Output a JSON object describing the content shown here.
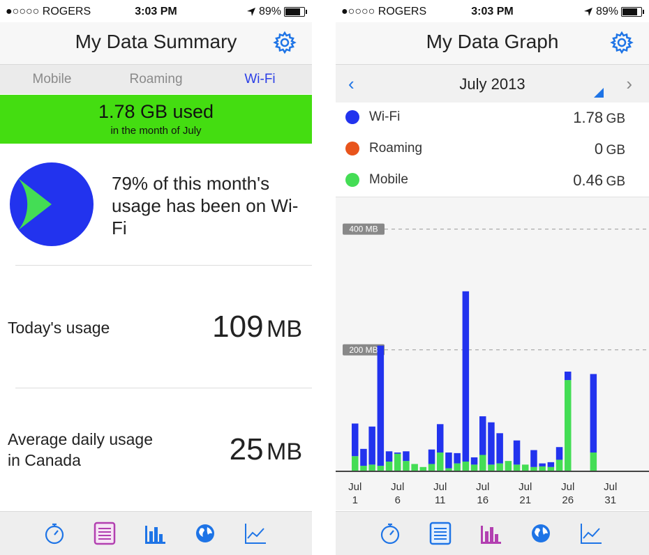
{
  "status": {
    "carrier": "●○○○○ ROGERS",
    "time": "3:03 PM",
    "battery": "89%",
    "battery_level": 0.89
  },
  "summary": {
    "title": "My Data Summary",
    "tabs": [
      "Mobile",
      "Roaming",
      "Wi-Fi"
    ],
    "active_tab": "Wi-Fi",
    "used_value": "1.78 GB used",
    "used_sub": "in the month of July",
    "pie_percent": "79",
    "pie_text": "% of this month's usage has been on Wi-Fi",
    "pie_fraction": 0.79,
    "today_label": "Today's usage",
    "today_value": "109",
    "today_unit": "MB",
    "average_label": "Average daily usage in Canada",
    "average_value": "25",
    "average_unit": "MB"
  },
  "graph": {
    "title": "My Data Graph",
    "month": "July 2013",
    "legend": [
      {
        "name": "Wi-Fi",
        "value": "1.78",
        "unit": "GB",
        "color": "#2233ee"
      },
      {
        "name": "Roaming",
        "value": "0",
        "unit": "GB",
        "color": "#e8541c"
      },
      {
        "name": "Mobile",
        "value": "0.46",
        "unit": "GB",
        "color": "#44dd55"
      }
    ]
  },
  "colors": {
    "wifi": "#2233ee",
    "mobile": "#44dd55",
    "accent": "#1e74e6",
    "banner": "#44dd11"
  },
  "icons": [
    "stopwatch-icon",
    "list-icon",
    "bar-chart-icon",
    "globe-icon",
    "line-chart-icon"
  ],
  "chart_data": {
    "type": "bar",
    "categories": [
      "Jul 1",
      "Jul 2",
      "Jul 3",
      "Jul 4",
      "Jul 5",
      "Jul 6",
      "Jul 7",
      "Jul 8",
      "Jul 9",
      "Jul 10",
      "Jul 11",
      "Jul 12",
      "Jul 13",
      "Jul 14",
      "Jul 15",
      "Jul 16",
      "Jul 17",
      "Jul 18",
      "Jul 19",
      "Jul 20",
      "Jul 21",
      "Jul 22",
      "Jul 23",
      "Jul 24",
      "Jul 25",
      "Jul 26",
      "Jul 27",
      "Jul 28",
      "Jul 29",
      "Jul 30",
      "Jul 31"
    ],
    "tick_labels": [
      {
        "top": "Jul",
        "bottom": "1",
        "index": 0
      },
      {
        "top": "Jul",
        "bottom": "6",
        "index": 5
      },
      {
        "top": "Jul",
        "bottom": "11",
        "index": 10
      },
      {
        "top": "Jul",
        "bottom": "16",
        "index": 15
      },
      {
        "top": "Jul",
        "bottom": "21",
        "index": 20
      },
      {
        "top": "Jul",
        "bottom": "26",
        "index": 25
      },
      {
        "top": "Jul",
        "bottom": "31",
        "index": 30
      }
    ],
    "series": [
      {
        "name": "Mobile",
        "color": "#44dd55",
        "values": [
          24,
          8,
          10,
          8,
          15,
          28,
          16,
          11,
          6,
          11,
          30,
          4,
          12,
          15,
          10,
          26,
          10,
          12,
          16,
          10,
          10,
          6,
          7,
          6,
          18,
          150,
          0,
          0,
          30,
          0,
          0
        ]
      },
      {
        "name": "Wi-Fi",
        "color": "#2233ee",
        "values": [
          54,
          28,
          63,
          199,
          17,
          2,
          16,
          0,
          0,
          24,
          47,
          26,
          17,
          282,
          12,
          64,
          70,
          50,
          0,
          40,
          0,
          28,
          5,
          8,
          21,
          14,
          0,
          0,
          130,
          0,
          0
        ]
      }
    ],
    "ylim": [
      0,
      440
    ],
    "gridlines": [
      {
        "value": 400,
        "label": "400 MB"
      },
      {
        "value": 200,
        "label": "200 MB"
      }
    ]
  }
}
